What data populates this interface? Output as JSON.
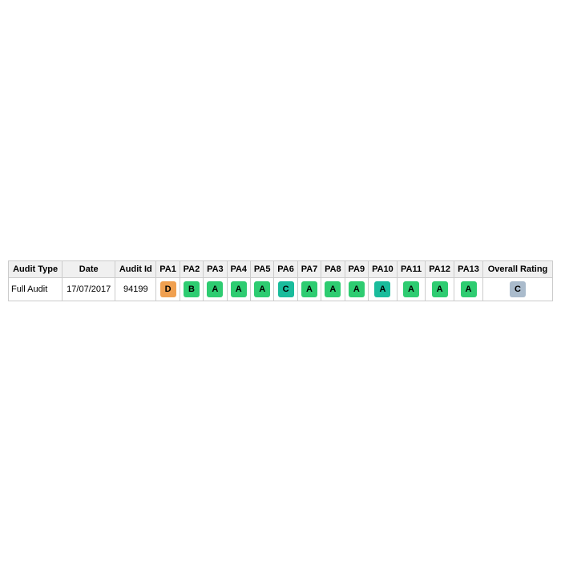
{
  "table": {
    "headers": [
      "Audit Type",
      "Date",
      "Audit Id",
      "PA1",
      "PA2",
      "PA3",
      "PA4",
      "PA5",
      "PA6",
      "PA7",
      "PA8",
      "PA9",
      "PA10",
      "PA11",
      "PA12",
      "PA13",
      "Overall Rating"
    ],
    "row": {
      "audit_type": "Full Audit",
      "date": "17/07/2017",
      "audit_id": "94199",
      "ratings": [
        {
          "label": "D",
          "style": "badge-orange"
        },
        {
          "label": "B",
          "style": "badge-green"
        },
        {
          "label": "A",
          "style": "badge-green"
        },
        {
          "label": "A",
          "style": "badge-green"
        },
        {
          "label": "A",
          "style": "badge-green"
        },
        {
          "label": "C",
          "style": "badge-teal"
        },
        {
          "label": "A",
          "style": "badge-green"
        },
        {
          "label": "A",
          "style": "badge-green"
        },
        {
          "label": "A",
          "style": "badge-green"
        },
        {
          "label": "A",
          "style": "badge-teal"
        },
        {
          "label": "A",
          "style": "badge-green"
        },
        {
          "label": "A",
          "style": "badge-green"
        },
        {
          "label": "A",
          "style": "badge-green"
        }
      ],
      "overall_rating": {
        "label": "C",
        "style": "badge-blue-gray"
      }
    }
  }
}
